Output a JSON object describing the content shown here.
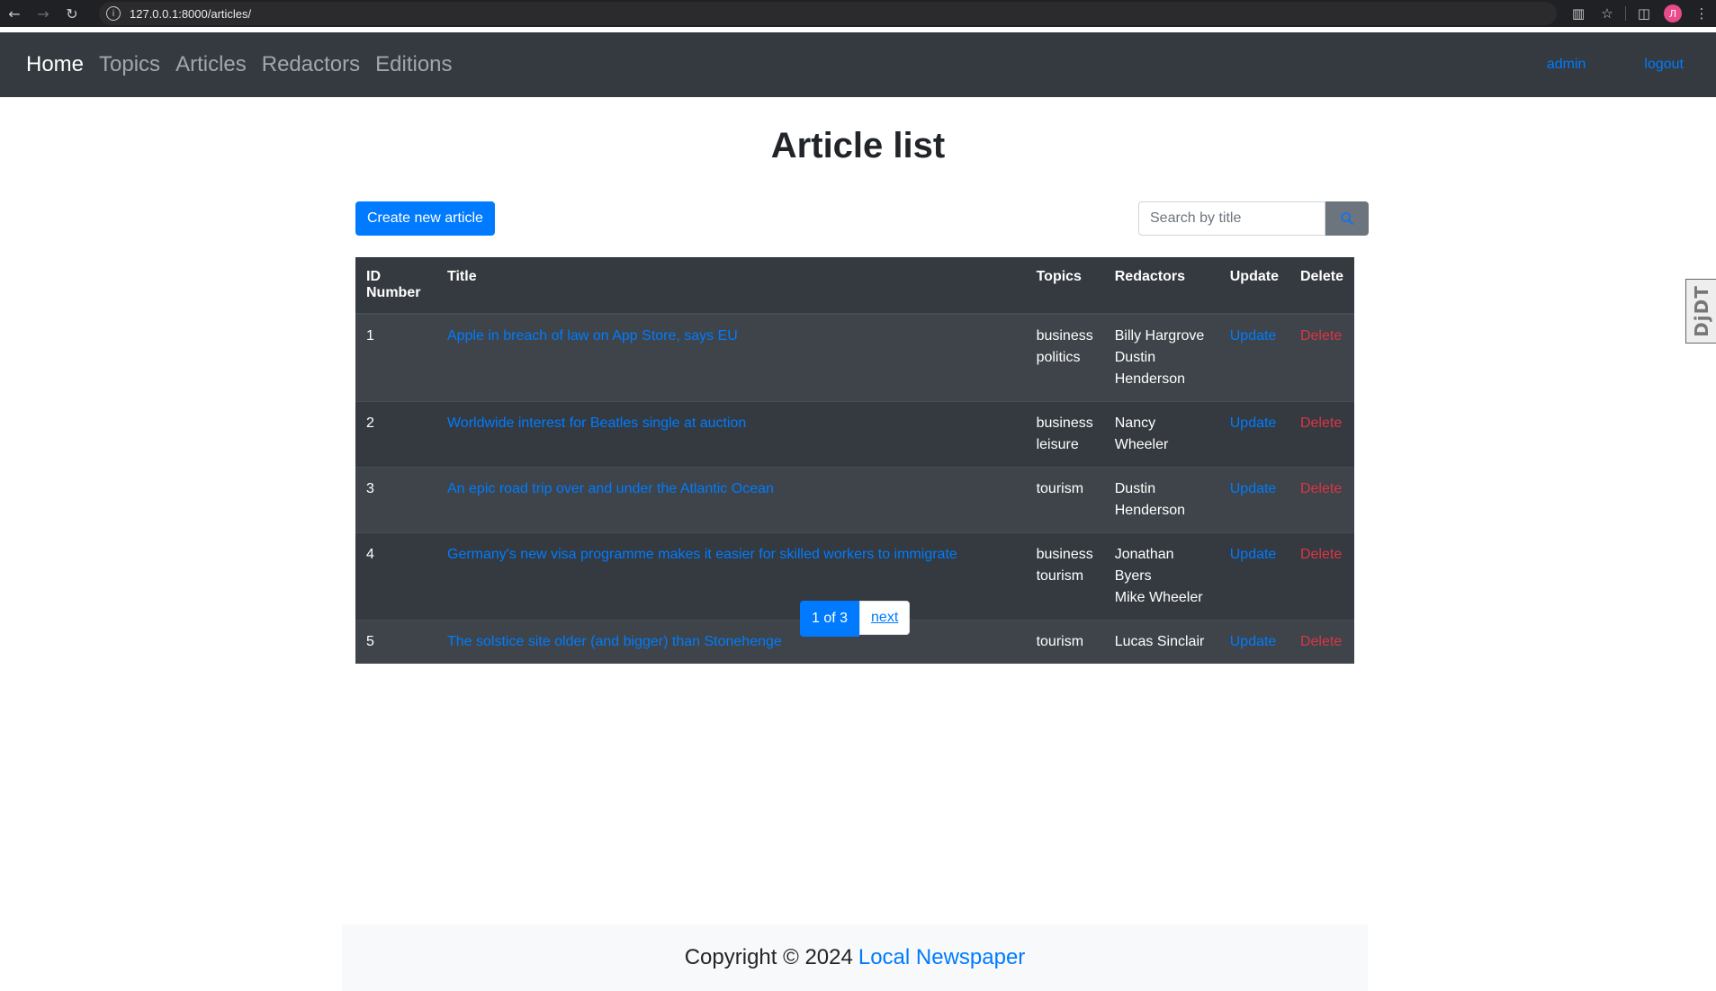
{
  "browser": {
    "url": "127.0.0.1:8000/articles/",
    "profile_initial": "Л"
  },
  "navbar": {
    "links": [
      "Home",
      "Topics",
      "Articles",
      "Redactors",
      "Editions"
    ],
    "active": "Home",
    "user": "admin",
    "logout": "logout"
  },
  "page": {
    "title": "Article list",
    "create_button": "Create new article",
    "search_placeholder": "Search by title"
  },
  "table": {
    "headers": [
      "ID Number",
      "Title",
      "Topics",
      "Redactors",
      "Update",
      "Delete"
    ],
    "rows": [
      {
        "id": "1",
        "title": "Apple in breach of law on App Store, says EU",
        "topics": [
          "business",
          "politics"
        ],
        "redactors": [
          "Billy Hargrove",
          "Dustin Henderson"
        ],
        "update": "Update",
        "delete": "Delete"
      },
      {
        "id": "2",
        "title": "Worldwide interest for Beatles single at auction",
        "topics": [
          "business",
          "leisure"
        ],
        "redactors": [
          "Nancy Wheeler"
        ],
        "update": "Update",
        "delete": "Delete"
      },
      {
        "id": "3",
        "title": "An epic road trip over and under the Atlantic Ocean",
        "topics": [
          "tourism"
        ],
        "redactors": [
          "Dustin Henderson"
        ],
        "update": "Update",
        "delete": "Delete"
      },
      {
        "id": "4",
        "title": "Germany's new visa programme makes it easier for skilled workers to immigrate",
        "topics": [
          "business",
          "tourism"
        ],
        "redactors": [
          "Jonathan Byers",
          "Mike Wheeler"
        ],
        "update": "Update",
        "delete": "Delete"
      },
      {
        "id": "5",
        "title": "The solstice site older (and bigger) than Stonehenge",
        "topics": [
          "tourism"
        ],
        "redactors": [
          "Lucas Sinclair"
        ],
        "update": "Update",
        "delete": "Delete"
      }
    ]
  },
  "pagination": {
    "current": "1 of 3",
    "next": "next"
  },
  "footer": {
    "text": "Copyright © 2024",
    "link": "Local Newspaper"
  },
  "debug_toolbar": {
    "label": "DjDT"
  },
  "colors": {
    "primary": "#007bff",
    "danger": "#dc3545",
    "dark": "#343a40"
  }
}
